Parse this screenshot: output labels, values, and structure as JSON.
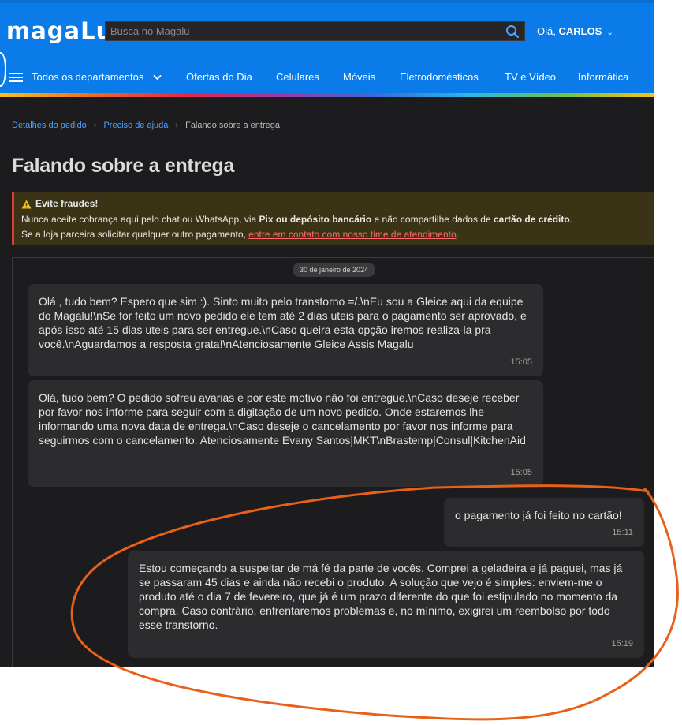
{
  "header": {
    "logo": "magaLu",
    "search_placeholder": "Busca no Magalu",
    "greeting_prefix": "Olá, ",
    "user_name": "CARLOS",
    "nav": [
      "Todos os departamentos",
      "Ofertas do Dia",
      "Celulares",
      "Móveis",
      "Eletrodomésticos",
      "TV e Vídeo",
      "Informática"
    ]
  },
  "breadcrumb": [
    "Detalhes do pedido",
    "Preciso de ajuda",
    "Falando sobre a entrega"
  ],
  "page_title": "Falando sobre a entrega",
  "alert": {
    "title": "Evite fraudes!",
    "line1_a": "Nunca aceite cobrança aqui pelo chat ou WhatsApp, via ",
    "line1_b": "Pix ou depósito bancário",
    "line1_c": " e não compartilhe dados de ",
    "line1_d": "cartão de crédito",
    "line1_e": ".",
    "line2_a": "Se a loja parceira solicitar qualquer outro pagamento, ",
    "line2_link": "entre em contato com nosso time de atendimento",
    "line2_end": "."
  },
  "chat": {
    "date": "30 de janeiro de 2024",
    "messages": [
      {
        "text": "Olá , tudo bem? Espero que sim :). Sinto muito pelo transtorno =/.\\nEu sou a Gleice aqui da equipe do Magalu!\\nSe for feito um novo pedido ele tem até 2 dias uteis para o pagamento ser aprovado, e após isso até 15 dias uteis para ser entregue.\\nCaso queira esta opção iremos realiza-la pra você.\\nAguardamos a resposta grata!\\nAtenciosamente Gleice Assis Magalu",
        "time": "15:05"
      },
      {
        "text": "Olá, tudo bem? O pedido sofreu avarias e por este motivo não foi entregue.\\nCaso deseje receber por favor nos informe para seguir com a digitação de um novo pedido. Onde estaremos lhe informando uma nova data de entrega.\\nCaso deseje o cancelamento por favor nos informe para seguirmos com o cancelamento. Atenciosamente Evany Santos|MKT\\nBrastemp|Consul|KitchenAid",
        "time": "15:05"
      },
      {
        "text": "o pagamento já foi feito no cartão!",
        "time": "15:11"
      },
      {
        "text": "Estou começando a suspeitar de má fé da parte de vocês. Comprei a geladeira e já paguei, mas já se passaram 45 dias e ainda não recebi o produto. A solução que vejo é simples: enviem-me o produto até o dia 7 de fevereiro, que já é um prazo diferente do que foi estipulado no momento da compra. Caso contrário, enfrentaremos problemas e, no mínimo, exigirei um reembolso por todo esse transtorno.",
        "time": "15:19"
      }
    ]
  },
  "colors": {
    "brand_blue": "#0a7be8",
    "background": "#1c1c1e",
    "bubble": "#2c2c2e",
    "link": "#4da3ff",
    "alert_bg": "#3b3315",
    "alert_border": "#e03b3b",
    "annotation": "#e8611a"
  },
  "icons": [
    "search-icon",
    "chevron-down-icon",
    "hamburger-icon",
    "breadcrumb-chevron-icon",
    "warning-icon"
  ]
}
